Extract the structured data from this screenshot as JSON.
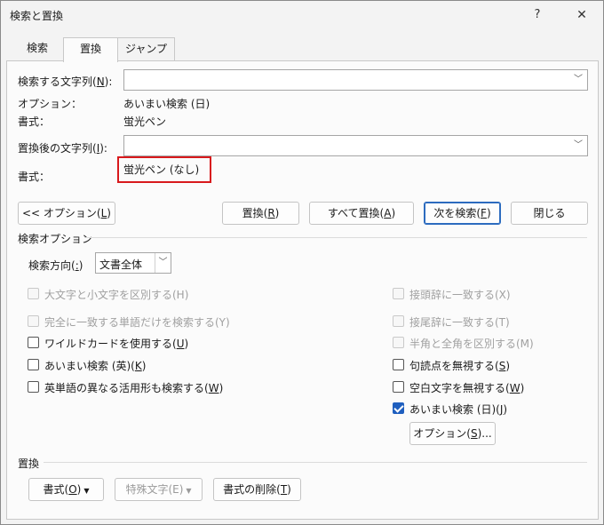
{
  "window": {
    "title": "検索と置換",
    "help": "?",
    "close": "✕"
  },
  "tabs": [
    {
      "label": "検索",
      "selected": false
    },
    {
      "label": "置換",
      "selected": true
    },
    {
      "label": "ジャンプ",
      "selected": false
    }
  ],
  "find": {
    "label_pre": "検索する文字列(",
    "label_key": "N",
    "label_post": "):",
    "value": "",
    "option_label": "オプション：",
    "option_value": "あいまい検索 (日)",
    "format_label": "書式：",
    "format_value": "蛍光ペン"
  },
  "replace": {
    "label_pre": "置換後の文字列(",
    "label_key": "I",
    "label_post": "):",
    "value": "",
    "format_label": "書式：",
    "format_value": "蛍光ペン (なし)"
  },
  "buttons": {
    "options": {
      "pre": "<< オプション(",
      "key": "L",
      "post": ")"
    },
    "replace": {
      "pre": "置換(",
      "key": "R",
      "post": ")"
    },
    "replace_all": {
      "pre": "すべて置換(",
      "key": "A",
      "post": ")"
    },
    "find_next": {
      "pre": "次を検索(",
      "key": "F",
      "post": ")"
    },
    "close": "閉じる"
  },
  "search_options": {
    "header": "検索オプション",
    "direction_label_pre": "検索方向(",
    "direction_label_key": ":",
    "direction_label_post": ")",
    "direction_value": "文書全体",
    "left": [
      {
        "label": "大文字と小文字を区別する(H)",
        "checked": false,
        "disabled": true
      },
      {
        "label": "完全に一致する単語だけを検索する(Y)",
        "checked": false,
        "disabled": true
      },
      {
        "pre": "ワイルドカードを使用する(",
        "key": "U",
        "post": ")",
        "checked": false,
        "disabled": false
      },
      {
        "pre": "あいまい検索 (英)(",
        "key": "K",
        "post": ")",
        "checked": false,
        "disabled": false
      },
      {
        "pre": "英単語の異なる活用形も検索する(",
        "key": "W",
        "post": ")",
        "checked": false,
        "disabled": false
      }
    ],
    "right": [
      {
        "label": "接頭辞に一致する(X)",
        "checked": false,
        "disabled": true
      },
      {
        "label": "接尾辞に一致する(T)",
        "checked": false,
        "disabled": true
      },
      {
        "label": "半角と全角を区別する(M)",
        "checked": false,
        "disabled": true
      },
      {
        "pre": "句読点を無視する(",
        "key": "S",
        "post": ")",
        "checked": false,
        "disabled": false
      },
      {
        "pre": "空白文字を無視する(",
        "key": "W",
        "post": ")",
        "checked": false,
        "disabled": false
      },
      {
        "pre": "あいまい検索 (日)(",
        "key": "J",
        "post": ")",
        "checked": true,
        "disabled": false
      }
    ],
    "fuzzy_options_button": {
      "pre": "オプション(",
      "key": "S",
      "post": ")..."
    }
  },
  "replace_section": {
    "header": "置換",
    "format_button": {
      "pre": "書式(",
      "key": "O",
      "post": ")"
    },
    "special_button": "特殊文字(E)",
    "clear_format_button": {
      "pre": "書式の削除(",
      "key": "T",
      "post": ")"
    }
  }
}
